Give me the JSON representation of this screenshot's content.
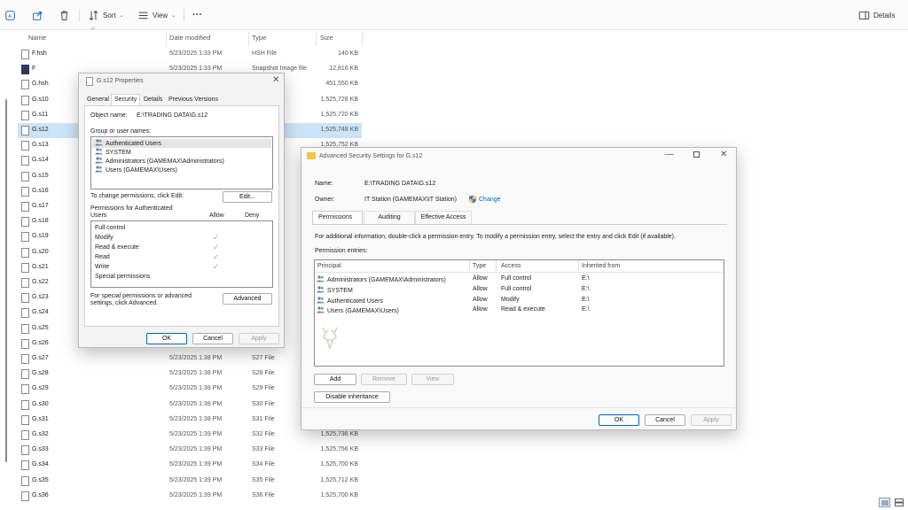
{
  "toolbar": {
    "sort_label": "Sort",
    "view_label": "View",
    "more_label": "···",
    "details_label": "Details"
  },
  "file_list": {
    "headers": {
      "name": "Name",
      "date": "Date modified",
      "type": "Type",
      "size": "Size"
    },
    "rows": [
      {
        "name": "F.hsh",
        "date": "5/23/2025 1:33 PM",
        "type": "HSH File",
        "size": "140 KB"
      },
      {
        "name": "F",
        "date": "5/23/2025 1:33 PM",
        "type": "Snapshot Image file",
        "size": "12,816 KB"
      },
      {
        "name": "G.hsh",
        "date": "",
        "type": "",
        "size": "451,550 KB"
      },
      {
        "name": "G.s10",
        "date": "",
        "type": "",
        "size": "1,525,728 KB"
      },
      {
        "name": "G.s11",
        "date": "",
        "type": "",
        "size": "1,525,720 KB"
      },
      {
        "name": "G.s12",
        "date": "",
        "type": "",
        "size": "1,525,748 KB"
      },
      {
        "name": "G.s13",
        "date": "",
        "type": "",
        "size": "1,525,752 KB"
      },
      {
        "name": "G.s14",
        "date": "",
        "type": "",
        "size": ""
      },
      {
        "name": "G.s15",
        "date": "",
        "type": "",
        "size": ""
      },
      {
        "name": "G.s16",
        "date": "",
        "type": "",
        "size": ""
      },
      {
        "name": "G.s17",
        "date": "",
        "type": "",
        "size": ""
      },
      {
        "name": "G.s18",
        "date": "",
        "type": "",
        "size": ""
      },
      {
        "name": "G.s19",
        "date": "",
        "type": "",
        "size": ""
      },
      {
        "name": "G.s20",
        "date": "",
        "type": "",
        "size": ""
      },
      {
        "name": "G.s21",
        "date": "",
        "type": "",
        "size": ""
      },
      {
        "name": "G.s22",
        "date": "",
        "type": "",
        "size": ""
      },
      {
        "name": "G.s23",
        "date": "",
        "type": "",
        "size": ""
      },
      {
        "name": "G.s24",
        "date": "",
        "type": "",
        "size": ""
      },
      {
        "name": "G.s25",
        "date": "",
        "type": "",
        "size": ""
      },
      {
        "name": "G.s26",
        "date": "",
        "type": "",
        "size": ""
      },
      {
        "name": "G.s27",
        "date": "5/23/2025 1:38 PM",
        "type": "S27 File",
        "size": ""
      },
      {
        "name": "G.s28",
        "date": "5/23/2025 1:38 PM",
        "type": "S28 File",
        "size": ""
      },
      {
        "name": "G.s29",
        "date": "5/23/2025 1:38 PM",
        "type": "S29 File",
        "size": ""
      },
      {
        "name": "G.s30",
        "date": "5/23/2025 1:38 PM",
        "type": "S30 File",
        "size": ""
      },
      {
        "name": "G.s31",
        "date": "5/23/2025 1:38 PM",
        "type": "S31 File",
        "size": ""
      },
      {
        "name": "G.s32",
        "date": "5/23/2025 1:39 PM",
        "type": "S32 File",
        "size": "1,525,736 KB"
      },
      {
        "name": "G.s33",
        "date": "5/23/2025 1:39 PM",
        "type": "S33 File",
        "size": "1,525,756 KB"
      },
      {
        "name": "G.s34",
        "date": "5/23/2025 1:39 PM",
        "type": "S34 File",
        "size": "1,525,700 KB"
      },
      {
        "name": "G.s35",
        "date": "5/23/2025 1:39 PM",
        "type": "S35 File",
        "size": "1,525,712 KB"
      },
      {
        "name": "G.s36",
        "date": "5/23/2025 1:39 PM",
        "type": "S36 File",
        "size": "1,525,700 KB"
      }
    ],
    "selected_index": 5
  },
  "props": {
    "title": "G.s12 Properties",
    "tabs": [
      "General",
      "Security",
      "Details",
      "Previous Versions"
    ],
    "object_name_label": "Object name:",
    "object_name_value": "E:\\TRADING DATA\\G.s12",
    "group_label": "Group or user names:",
    "groups": [
      "Authenticated Users",
      "SYSTEM",
      "Administrators (GAMEMAX\\Administrators)",
      "Users (GAMEMAX\\Users)"
    ],
    "change_perm_text": "To change permissions, click Edit.",
    "edit_label": "Edit...",
    "perm_for_label": "Permissions for Authenticated Users",
    "allow_label": "Allow",
    "deny_label": "Deny",
    "permissions": [
      "Full control",
      "Modify",
      "Read & execute",
      "Read",
      "Write",
      "Special permissions"
    ],
    "allowed": [
      false,
      true,
      true,
      true,
      true,
      false
    ],
    "special_text": "For special permissions or advanced settings, click Advanced.",
    "advanced_label": "Advanced",
    "ok_label": "OK",
    "cancel_label": "Cancel",
    "apply_label": "Apply"
  },
  "adv": {
    "title": "Advanced Security Settings for G.s12",
    "name_label": "Name:",
    "name_value": "E:\\TRADING DATA\\G.s12",
    "owner_label": "Owner:",
    "owner_value": "IT Station (GAMEMAX\\IT Station)",
    "change_label": "Change",
    "tabs": [
      "Permissions",
      "Auditing",
      "Effective Access"
    ],
    "info_text": "For additional information, double-click a permission entry. To modify a permission entry, select the entry and click Edit (if available).",
    "entries_label": "Permission entries:",
    "headers": {
      "principal": "Principal",
      "type": "Type",
      "access": "Access",
      "inherited": "Inherited from"
    },
    "entries": [
      {
        "principal": "Administrators (GAMEMAX\\Administrators)",
        "type": "Allow",
        "access": "Full control",
        "inherited": "E:\\"
      },
      {
        "principal": "SYSTEM",
        "type": "Allow",
        "access": "Full control",
        "inherited": "E:\\"
      },
      {
        "principal": "Authenticated Users",
        "type": "Allow",
        "access": "Modify",
        "inherited": "E:\\"
      },
      {
        "principal": "Users (GAMEMAX\\Users)",
        "type": "Allow",
        "access": "Read & execute",
        "inherited": "E:\\"
      }
    ],
    "add_label": "Add",
    "remove_label": "Remove",
    "view_label": "View",
    "disable_inh_label": "Disable inheritance",
    "ok_label": "OK",
    "cancel_label": "Cancel",
    "apply_label": "Apply"
  },
  "colors": {
    "accent": "#0067c0",
    "selection": "#cce4f7",
    "folder": "#f4c542"
  }
}
